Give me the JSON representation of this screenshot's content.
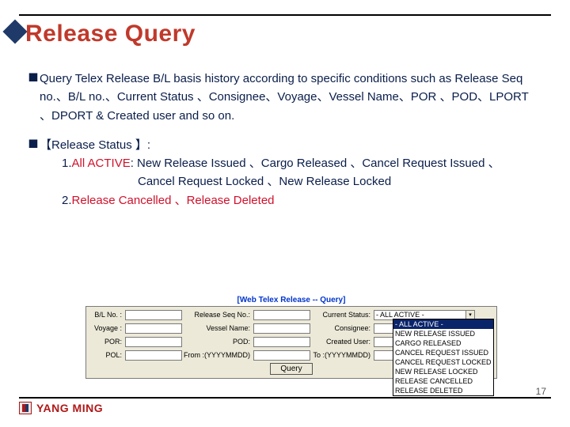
{
  "title": "Release Query",
  "bullets": {
    "b1": "Query Telex Release B/L basis history according to specific conditions such as Release Seq no.、B/L no.、Current Status 、Consignee、Voyage、Vessel Name、POR 、POD、LPORT 、DPORT & Created user and so on.",
    "b2_head": "【Release Status 】:",
    "b2_1_label": "1.",
    "b2_1_red": "All ACTIVE",
    "b2_1_rest": ": New Release Issued 、Cargo Released 、Cancel Request Issued 、",
    "b2_1_line2": "Cancel Request Locked 、New Release Locked",
    "b2_2_label": "2.",
    "b2_2_red": "Release Cancelled 、Release Deleted"
  },
  "screenshot": {
    "caption": "[Web Telex Release -- Query]",
    "labels": {
      "bl": "B/L No. :",
      "seq": "Release Seq No.:",
      "status": "Current Status:",
      "voyage": "Voyage :",
      "vessel": "Vessel Name:",
      "consignee": "Consignee:",
      "por": "POR:",
      "pod": "POD:",
      "created": "Created User:",
      "pol": "POL:",
      "from": "From :(YYYYMMDD)",
      "to": "To :(YYYYMMDD)"
    },
    "status_selected": "- ALL ACTIVE -",
    "status_options": [
      "- ALL ACTIVE -",
      "NEW RELEASE ISSUED",
      "CARGO RELEASED",
      "CANCEL REQUEST ISSUED",
      "CANCEL REQUEST LOCKED",
      "NEW RELEASE LOCKED",
      "RELEASE CANCELLED",
      "RELEASE DELETED"
    ],
    "query_btn": "Query"
  },
  "page_number": "17",
  "brand": "YANG MING"
}
